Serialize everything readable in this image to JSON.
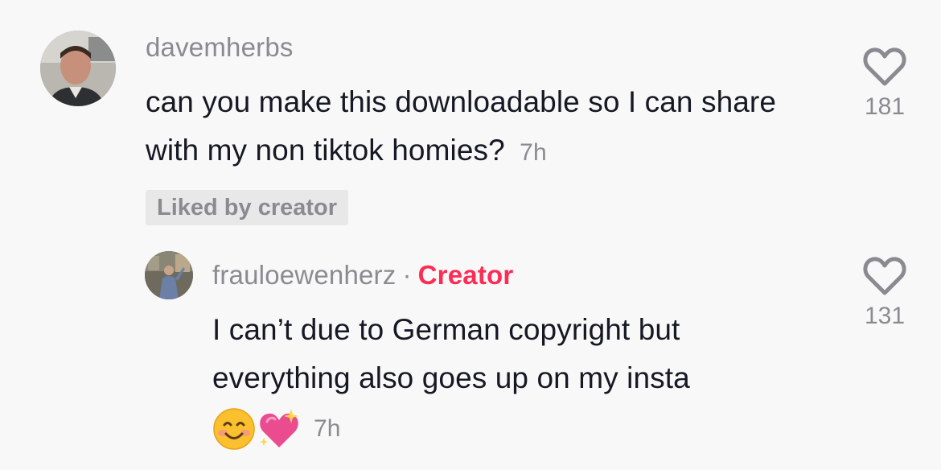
{
  "comments": [
    {
      "username": "davemherbs",
      "text": "can you make this downloadable so I can share with my non tiktok homies?",
      "time": "7h",
      "badge": "Liked by creator",
      "likes": "181",
      "icons": {
        "like": "heart-outline-icon",
        "avatar": "user-photo-avatar"
      }
    },
    {
      "username": "frauloewenherz",
      "separator": "·",
      "role": "Creator",
      "text_line1": "I can’t due to German copyright but",
      "text_line2": "everything also goes up on my insta",
      "time": "7h",
      "likes": "131",
      "emojis": [
        "smiling-face-emoji",
        "sparkling-heart-emoji"
      ],
      "icons": {
        "like": "heart-outline-icon",
        "avatar": "user-photo-avatar"
      }
    }
  ],
  "colors": {
    "background": "#f8f8f8",
    "text": "#161823",
    "muted": "#8a8b91",
    "creator": "#fe2c55",
    "badge_bg": "#e8e8e9"
  }
}
